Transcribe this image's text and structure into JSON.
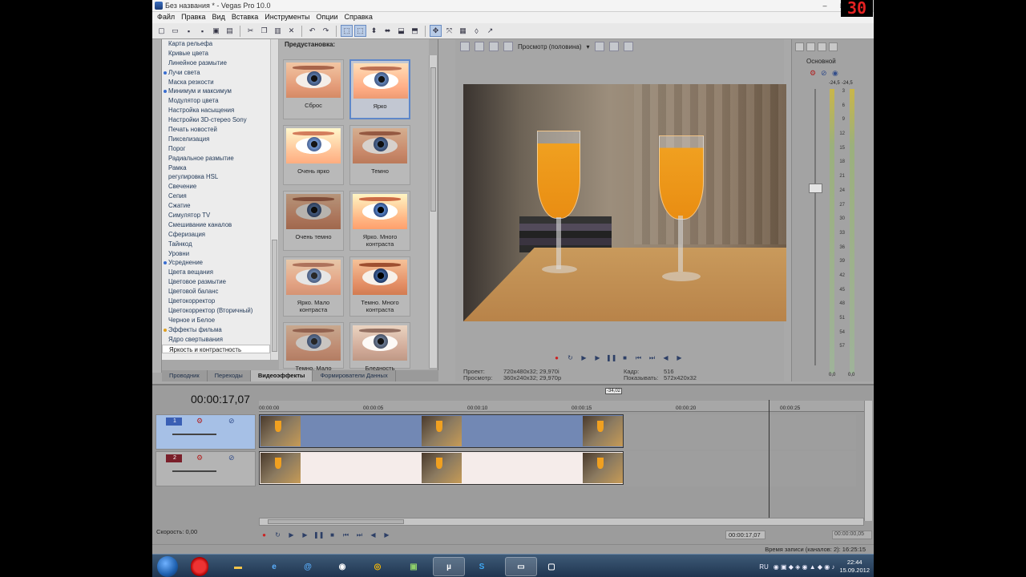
{
  "window": {
    "title": "Без названия * - Vegas Pro 10.0",
    "min": "–",
    "max": "□",
    "close": "✕"
  },
  "menu": [
    "Файл",
    "Правка",
    "Вид",
    "Вставка",
    "Инструменты",
    "Опции",
    "Справка"
  ],
  "fx_list": [
    "Карта рельефа",
    "Кривые цвета",
    "Линейное размытие",
    "Лучи света",
    "Маска резкости",
    "Минимум и максимум",
    "Модулятор цвета",
    "Настройка насыщения",
    "Настройки 3D-стерео Sony",
    "Печать новостей",
    "Пикселизация",
    "Порог",
    "Радиальное размытие",
    "Рамка",
    "регулировка HSL",
    "Свечение",
    "Сепия",
    "Сжатие",
    "Симулятор TV",
    "Смешивание каналов",
    "Сферизация",
    "Тайнкод",
    "Уровни",
    "Усреднение",
    "Цвета вещания",
    "Цветовое размытие",
    "Цветовой баланс",
    "Цветокорректор",
    "Цветокорректор (Вторичный)",
    "Черное и Белое",
    "Эффекты фильма",
    "Ядро свертывания",
    "Яркость и контрастность"
  ],
  "presets": {
    "header": "Предустановка:",
    "items": [
      "Сброс",
      "Ярко",
      "Очень ярко",
      "Темно",
      "Очень темно",
      "Ярко. Много контраста",
      "Ярко. Мало контраста",
      "Темно. Много контраста",
      "Темно. Мало",
      "Бледность"
    ]
  },
  "tabs": [
    "Проводник",
    "Переходы",
    "Видеоэффекты",
    "Формирователи Данных"
  ],
  "preview": {
    "mode": "Просмотр (половина)",
    "project_label": "Проект:",
    "project_value": "720x480x32; 29,970i",
    "preview_label": "Просмотр:",
    "preview_value": "360x240x32; 29,970p",
    "frame_label": "Кадр:",
    "frame_value": "516",
    "display_label": "Показывать:",
    "display_value": "572x420x32"
  },
  "mixer": {
    "bus": "Основной",
    "left_db": "-24,5",
    "right_db": "-24,5",
    "scale": [
      "3",
      "6",
      "9",
      "12",
      "15",
      "18",
      "21",
      "24",
      "27",
      "30",
      "33",
      "36",
      "39",
      "42",
      "45",
      "48",
      "51",
      "54",
      "57"
    ],
    "bottom_left": "0,0",
    "bottom_right": "0,0"
  },
  "timeline": {
    "timecode": "00:00:17,07",
    "marker": "-34,02",
    "ruler": [
      "00:00:00",
      "00:00:05",
      "00:00:10",
      "00:00:15",
      "00:00:20",
      "00:00:25"
    ],
    "track1": "1",
    "track2": "2",
    "speed": "Скорость: 0,00",
    "cursor_tc": "00:00:17,07",
    "end_tc": "00:00:00,05"
  },
  "status": "Время записи (каналов: 2): 16:25:15",
  "taskbar": {
    "lang": "RU",
    "time": "22:44",
    "date": "15.09.2012"
  },
  "fps": "30"
}
